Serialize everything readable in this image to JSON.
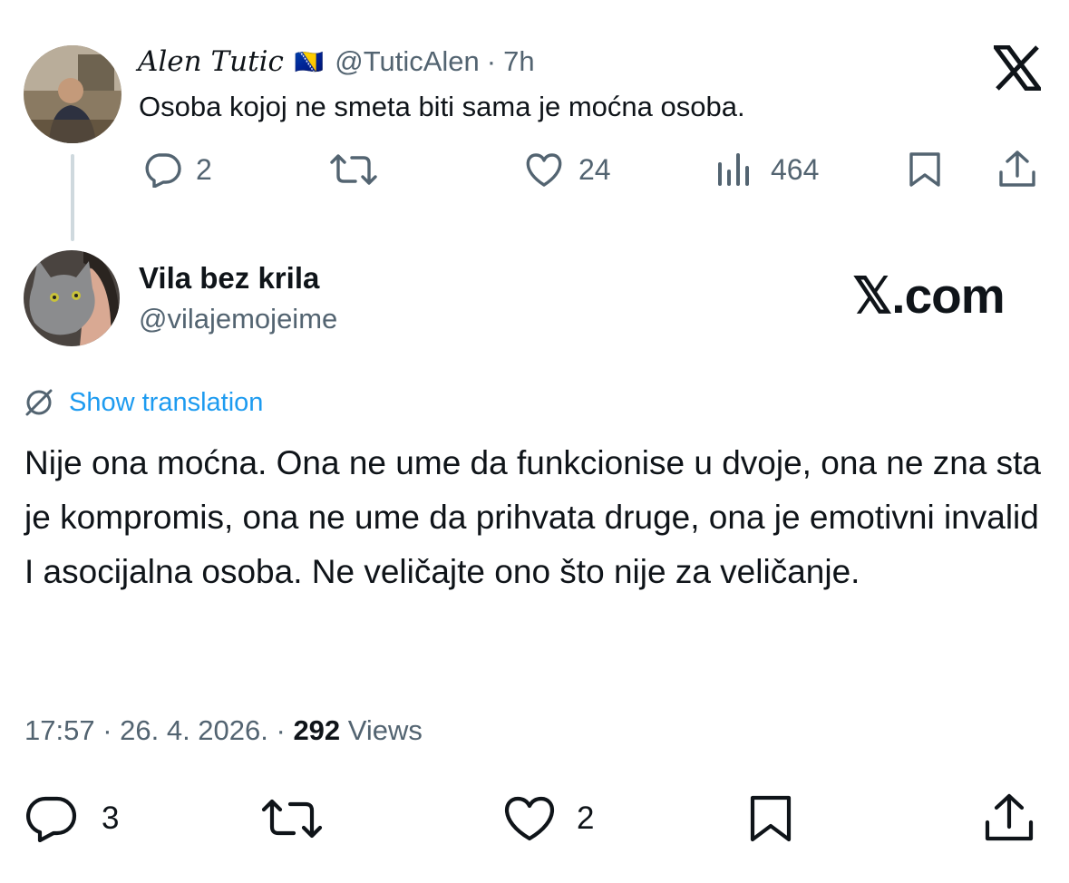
{
  "parent_tweet": {
    "display_name": "Alen Tutic",
    "flag": "🇧🇦",
    "handle": "@TuticAlen",
    "separator": "·",
    "time": "7h",
    "text": "Osoba kojoj ne smeta biti sama je moćna osoba.",
    "replies": "2",
    "likes": "24",
    "views": "464"
  },
  "reply_tweet": {
    "display_name": "Vila bez krila",
    "handle": "@vilajemojeime",
    "show_translation": "Show translation",
    "text": "Nije ona moćna. Ona ne ume da funkcionise u dvoje, ona ne zna sta je kompromis, ona ne ume da prihvata druge, ona je emotivni invalid I asocijalna osoba. Ne veličajte ono što nije za veličanje.",
    "timestamp": "17:57 · 26. 4. 2026. · ",
    "views_count": "292",
    "views_label": " Views",
    "replies": "3",
    "likes": "2"
  },
  "branding": {
    "logo_text": "𝕏.com"
  },
  "colors": {
    "text": "#0f1419",
    "muted": "#536471",
    "link": "#1d9bf0",
    "thread_line": "#cfd9de"
  }
}
